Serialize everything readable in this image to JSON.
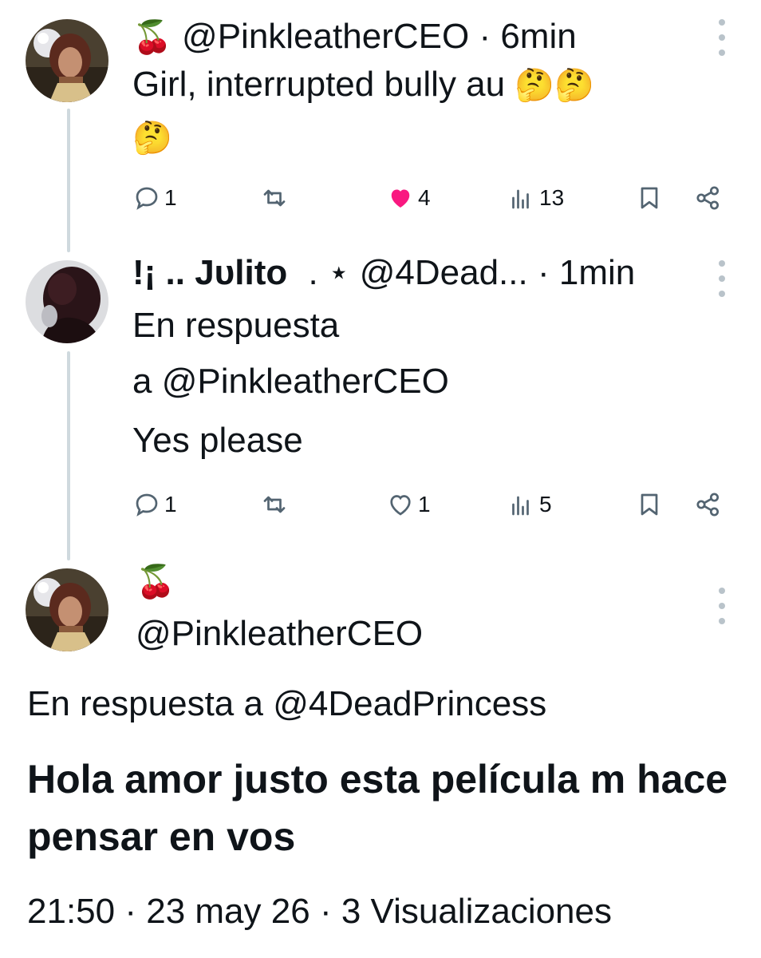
{
  "tweets": [
    {
      "emoji": "🍒",
      "handle": "@PinkleatherCEO",
      "separator": "·",
      "time": "6min",
      "text": "Girl, interrupted bully au",
      "text_emojis": "🤔🤔",
      "text_emoji_line2": "🤔",
      "stats": {
        "replies": "1",
        "likes": "4",
        "views": "13"
      },
      "liked": true,
      "like_color": "#f91880"
    },
    {
      "display_name": "!¡ .. Jυlito",
      "name_suffix": ". ⋆",
      "handle": "@4Dead...",
      "separator": "·",
      "time": "1min",
      "reply_to_label": "En respuesta",
      "reply_to_handle": "a @PinkleatherCEO",
      "text": "Yes please",
      "stats": {
        "replies": "1",
        "likes": "1",
        "views": "5"
      },
      "liked": false
    }
  ],
  "main_tweet": {
    "emoji": "🍒",
    "handle": "@PinkleatherCEO",
    "reply_to": "En respuesta a @4DeadPrincess",
    "text": "Hola amor justo esta película m hace pensar en vos",
    "time": "21:50",
    "sep1": "·",
    "date": "23 may 26",
    "sep2": "·",
    "views": "3 Visualizaciones"
  },
  "colors": {
    "text": "#0f1419",
    "muted": "#536471",
    "thread_line": "#cfd9de",
    "like": "#f91880"
  }
}
